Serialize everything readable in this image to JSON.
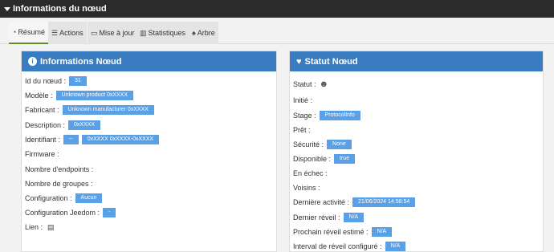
{
  "window": {
    "title": "Informations du nœud"
  },
  "tabs": [
    {
      "label": "Résumé",
      "icon": "dashboard-icon"
    },
    {
      "label": "Actions",
      "icon": "list-icon"
    },
    {
      "label": "Mise à jour",
      "icon": "drive-icon"
    },
    {
      "label": "Statistiques",
      "icon": "chart-icon"
    },
    {
      "label": "Arbre",
      "icon": "bell-icon"
    }
  ],
  "colors": {
    "panel_header": "#3a7cc0",
    "badge": "#5aa0e6",
    "active_tab_accent": "#5b8f2a",
    "titlebar": "#2b2b2b"
  },
  "info_panel": {
    "title": "Informations Nœud",
    "rows": [
      {
        "label": "Id du nœud :",
        "badges": [
          "31"
        ]
      },
      {
        "label": "Modèle :",
        "badges": [
          "Unknown product 0xXXXX"
        ]
      },
      {
        "label": "Fabricant :",
        "badges": [
          "Unknown manufacturer 0xXXXX"
        ]
      },
      {
        "label": "Description :",
        "badges": [
          "0xXXXX"
        ]
      },
      {
        "label": "Identifiant :",
        "badges": [
          "--",
          "0xXXXX 0xXXXX-0xXXXX"
        ]
      },
      {
        "label": "Firmware :",
        "badges": []
      },
      {
        "label": "Nombre d'endpoints :",
        "badges": []
      },
      {
        "label": "Nombre de groupes :",
        "badges": []
      },
      {
        "label": "Configuration :",
        "badges": [
          "Aucun"
        ]
      },
      {
        "label": "Configuration Jeedom :",
        "badges": [
          "-"
        ]
      },
      {
        "label": "Lien :",
        "badges": [],
        "icon": "book-icon"
      }
    ]
  },
  "status_panel": {
    "title": "Statut Nœud",
    "rows": [
      {
        "label": "Statut :",
        "badges": [],
        "icon": "smiley-icon"
      },
      {
        "label": "Initié :",
        "badges": []
      },
      {
        "label": "Stage :",
        "badges": [
          "ProtocolInfo"
        ]
      },
      {
        "label": "Prêt :",
        "badges": []
      },
      {
        "label": "Sécurité :",
        "badges": [
          "None"
        ]
      },
      {
        "label": "Disponible :",
        "badges": [
          "true"
        ]
      },
      {
        "label": "En échec :",
        "badges": []
      },
      {
        "label": "Voisins :",
        "badges": []
      },
      {
        "label": "Dernière activité :",
        "badges": [
          "21/06/2024 14:58:54"
        ]
      },
      {
        "label": "Dernier réveil :",
        "badges": [
          "N/A"
        ]
      },
      {
        "label": "Prochain réveil estimé :",
        "badges": [
          "N/A"
        ]
      },
      {
        "label": "Interval de réveil configuré :",
        "badges": [
          "N/A"
        ]
      }
    ]
  }
}
